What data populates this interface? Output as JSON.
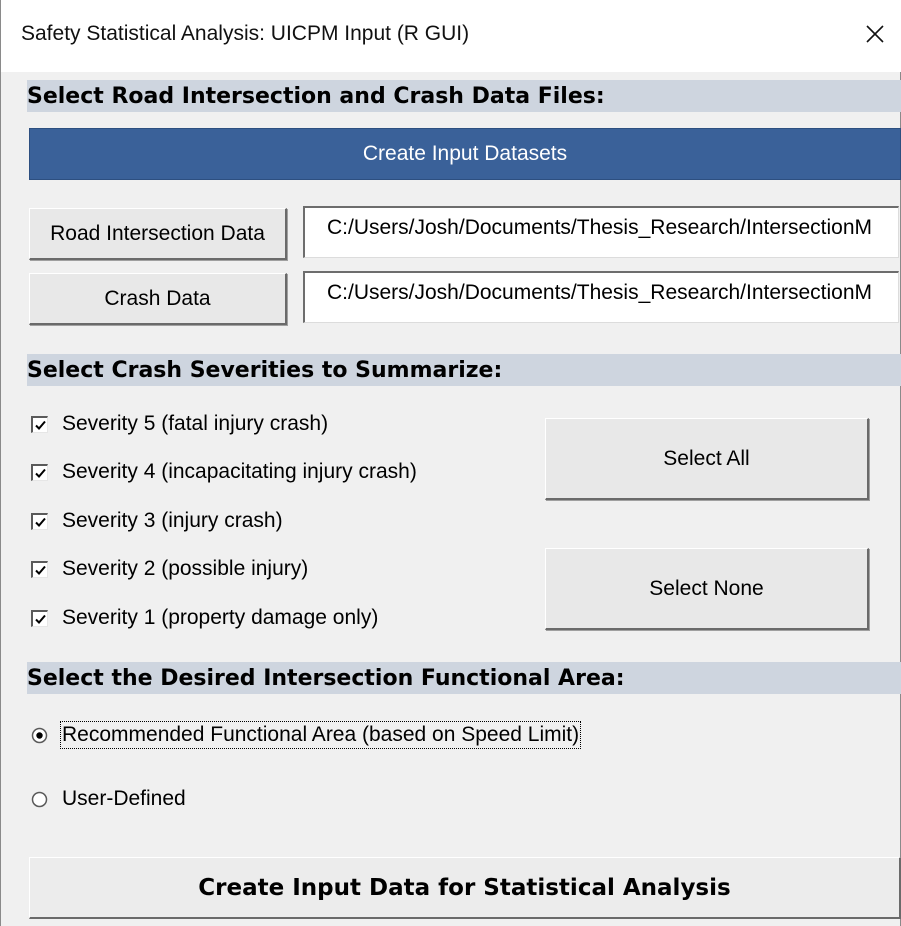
{
  "window": {
    "title": "Safety Statistical Analysis: UICPM Input (R GUI)",
    "close_icon": "close-icon"
  },
  "files_section": {
    "heading": "Select Road Intersection and Crash Data Files:",
    "create_datasets_label": "Create Input Datasets",
    "road_button_label": "Road Intersection Data",
    "road_path": "C:/Users/Josh/Documents/Thesis_Research/IntersectionM",
    "crash_button_label": "Crash Data",
    "crash_path": "C:/Users/Josh/Documents/Thesis_Research/IntersectionM"
  },
  "severity_section": {
    "heading": "Select Crash Severities to Summarize:",
    "items": [
      {
        "label": "Severity 5 (fatal injury crash)",
        "checked": true
      },
      {
        "label": "Severity 4 (incapacitating injury crash)",
        "checked": true
      },
      {
        "label": "Severity 3 (injury crash)",
        "checked": true
      },
      {
        "label": "Severity 2 (possible injury)",
        "checked": true
      },
      {
        "label": "Severity 1 (property damage only)",
        "checked": true
      }
    ],
    "select_all_label": "Select All",
    "select_none_label": "Select None"
  },
  "area_section": {
    "heading": "Select the Desired Intersection Functional Area:",
    "options": [
      {
        "label": "Recommended Functional Area (based on Speed Limit)",
        "selected": true
      },
      {
        "label": "User-Defined",
        "selected": false
      }
    ]
  },
  "footer": {
    "run_label": "Create Input Data for Statistical Analysis"
  },
  "colors": {
    "primary_button": "#3a6199",
    "section_bar": "#ced5df",
    "window_bg": "#f0f0f0"
  }
}
